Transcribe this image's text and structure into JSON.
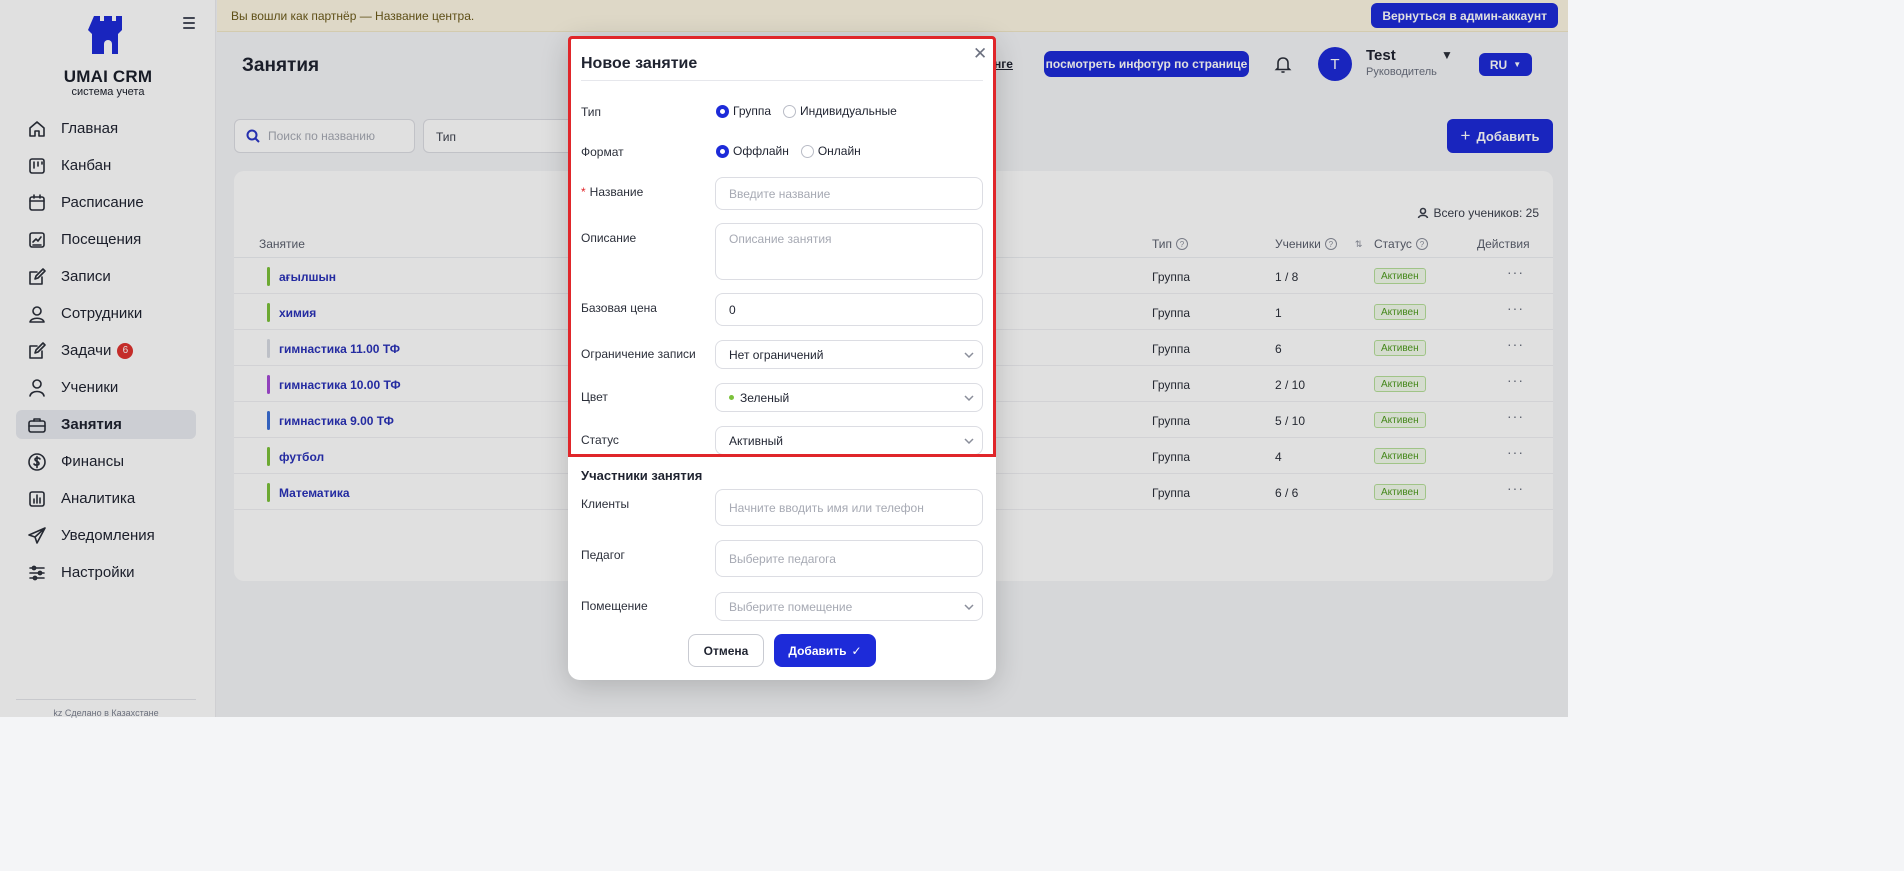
{
  "brand": {
    "title": "UMAI CRM",
    "subtitle": "система учета"
  },
  "sidebar": {
    "items": [
      {
        "label": "Главная",
        "icon": "home-icon"
      },
      {
        "label": "Канбан",
        "icon": "kanban-icon"
      },
      {
        "label": "Расписание",
        "icon": "calendar-icon"
      },
      {
        "label": "Посещения",
        "icon": "attendance-icon"
      },
      {
        "label": "Записи",
        "icon": "edit-icon"
      },
      {
        "label": "Сотрудники",
        "icon": "staff-icon"
      },
      {
        "label": "Задачи",
        "icon": "tasks-icon",
        "badge": "6"
      },
      {
        "label": "Ученики",
        "icon": "user-icon"
      },
      {
        "label": "Занятия",
        "icon": "briefcase-icon",
        "active": true
      },
      {
        "label": "Финансы",
        "icon": "dollar-icon"
      },
      {
        "label": "Аналитика",
        "icon": "analytics-icon"
      },
      {
        "label": "Уведомления",
        "icon": "send-icon"
      },
      {
        "label": "Настройки",
        "icon": "sliders-icon"
      }
    ],
    "footer": "kz Сделано в Казахстане"
  },
  "banner": {
    "text": "Вы вошли как партнёр — Название центра.",
    "button": "Вернуться в админ-аккаунт"
  },
  "header": {
    "title": "Занятия",
    "lang_hint": "нге",
    "tour_button": "посмотреть инфотур по странице",
    "user_initial": "T",
    "user_name": "Test",
    "user_role": "Руководитель",
    "lang": "RU"
  },
  "filters": {
    "search_placeholder": "Поиск по названию",
    "type_placeholder": "Тип",
    "add_button": "Добавить"
  },
  "table": {
    "total": "Всего учеников: 25",
    "columns": {
      "name": "Занятие",
      "type": "Тип",
      "students": "Ученики",
      "status": "Статус",
      "actions": "Действия"
    },
    "rows": [
      {
        "name": "ағылшын",
        "type": "Группа",
        "students": "1 / 8",
        "status": "Активен",
        "color": "#7bc13a"
      },
      {
        "name": "химия",
        "type": "Группа",
        "students": "1",
        "status": "Активен",
        "color": "#7bc13a"
      },
      {
        "name": "гимнастика 11.00 ТФ",
        "type": "Группа",
        "students": "6",
        "status": "Активен",
        "color": "#d8dbe3"
      },
      {
        "name": "гимнастика 10.00 ТФ",
        "type": "Группа",
        "students": "2 / 10",
        "status": "Активен",
        "color": "#a64bd6"
      },
      {
        "name": "гимнастика 9.00 ТФ",
        "type": "Группа",
        "students": "5 / 10",
        "status": "Активен",
        "color": "#3b6fd8"
      },
      {
        "name": "футбол",
        "type": "Группа",
        "students": "4",
        "status": "Активен",
        "color": "#7bc13a"
      },
      {
        "name": "Математика",
        "type": "Группа",
        "students": "6 / 6",
        "status": "Активен",
        "color": "#7bc13a"
      }
    ]
  },
  "modal": {
    "title": "Новое занятие",
    "type_label": "Тип",
    "type_options": [
      "Группа",
      "Индивидуальные"
    ],
    "format_label": "Формат",
    "format_options": [
      "Оффлайн",
      "Онлайн"
    ],
    "name_label": "Название",
    "name_placeholder": "Введите название",
    "desc_label": "Описание",
    "desc_placeholder": "Описание занятия",
    "price_label": "Базовая цена",
    "price_value": "0",
    "limit_label": "Ограничение записи",
    "limit_value": "Нет ограничений",
    "color_label": "Цвет",
    "color_value": "Зеленый",
    "status_label": "Статус",
    "status_value": "Активный",
    "participants_title": "Участники занятия",
    "clients_label": "Клиенты",
    "clients_placeholder": "Начните вводить имя или телефон",
    "teacher_label": "Педагог",
    "teacher_placeholder": "Выберите педагога",
    "room_label": "Помещение",
    "room_placeholder": "Выберите помещение",
    "cancel": "Отмена",
    "submit": "Добавить"
  },
  "colors": {
    "primary": "#1d2bd9",
    "highlight": "#e0262a",
    "active_status": "#4e9a1e"
  }
}
